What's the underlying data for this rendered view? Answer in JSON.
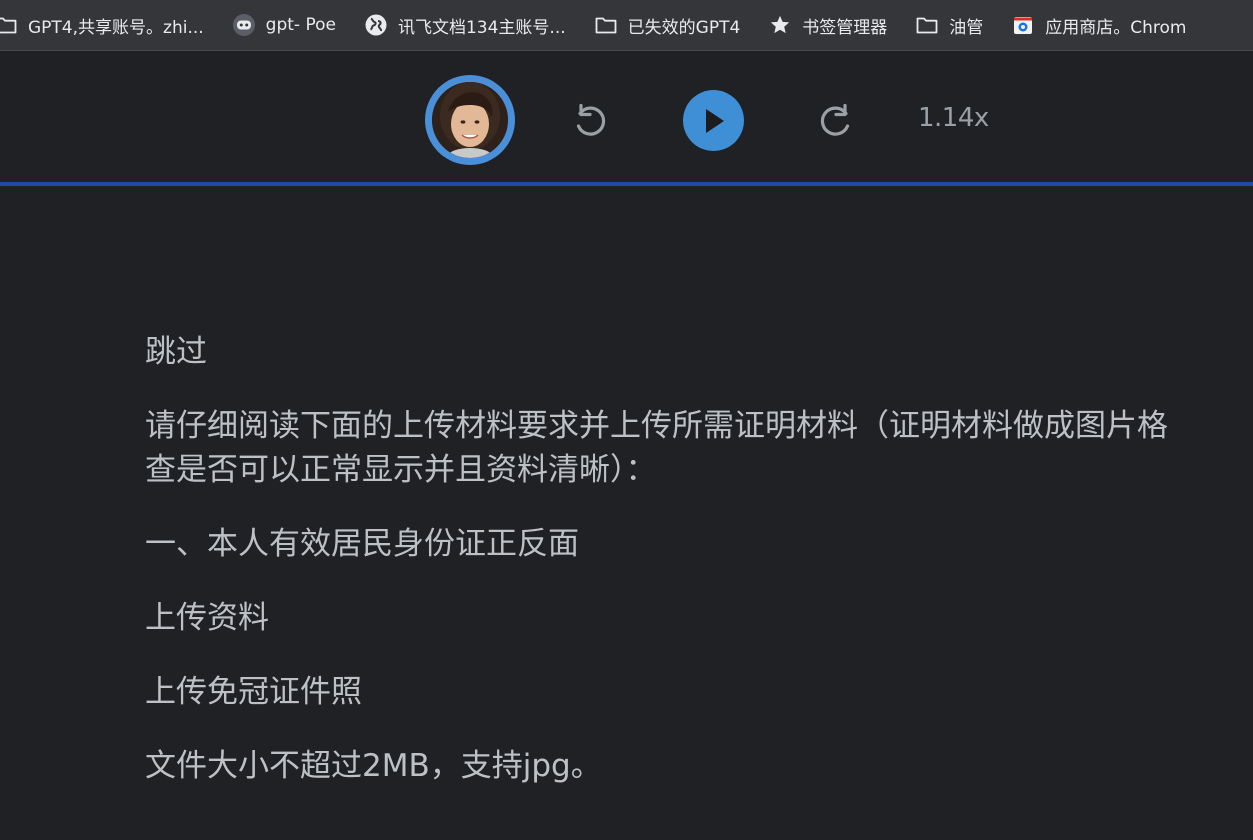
{
  "bookmarks": [
    {
      "label": "GPT4,共享账号。zhi...",
      "icon": "folder-icon"
    },
    {
      "label": "gpt- Poe",
      "icon": "poe-robot-icon"
    },
    {
      "label": "讯飞文档134主账号...",
      "icon": "globe-icon"
    },
    {
      "label": "已失效的GPT4",
      "icon": "folder-icon"
    },
    {
      "label": "书签管理器",
      "icon": "star-icon"
    },
    {
      "label": "油管",
      "icon": "folder-icon"
    },
    {
      "label": "应用商店。Chrom",
      "icon": "chrome-web-store-icon"
    }
  ],
  "player": {
    "speed": "1.14x",
    "accent_color": "#3e8fd6",
    "progress_color": "#1f4aa8"
  },
  "content": {
    "skip": "跳过",
    "instruction_line1": "请仔细阅读下面的上传材料要求并上传所需证明材料（证明材料做成图片格",
    "instruction_line2": "查是否可以正常显示并且资料清晰）：",
    "item1": "一、本人有效居民身份证正反面",
    "upload_materials": "上传资料",
    "upload_id_photo": "上传免冠证件照",
    "file_limit": "文件大小不超过2MB，支持jpg。"
  }
}
